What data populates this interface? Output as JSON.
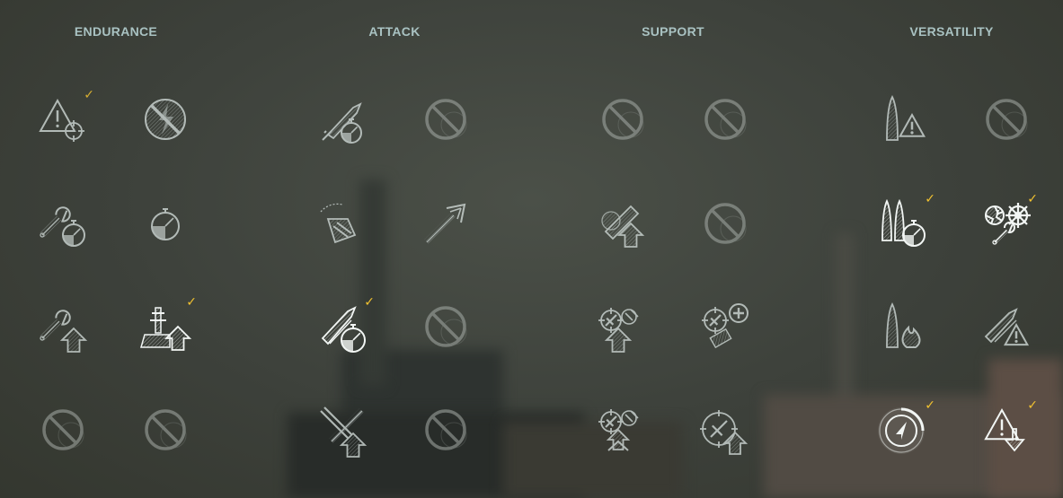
{
  "columns": [
    {
      "title": "ENDURANCE",
      "skills": [
        {
          "name": "incoming-fire-alert-icon",
          "icon": "alert",
          "state": "learned",
          "selected": true
        },
        {
          "name": "no-lightning-icon",
          "icon": "no-bolt",
          "state": "learned",
          "selected": false
        },
        {
          "name": "wrench-timer-icon",
          "icon": "wrench-timer",
          "state": "learned",
          "selected": false
        },
        {
          "name": "stopwatch-icon",
          "icon": "stopwatch",
          "state": "learned",
          "selected": false
        },
        {
          "name": "wrench-up-icon",
          "icon": "wrench-up",
          "state": "learned",
          "selected": false
        },
        {
          "name": "ship-up-icon",
          "icon": "ship-up",
          "state": "active",
          "selected": true
        },
        {
          "name": "locked-skill-icon",
          "icon": "blocked",
          "state": "locked",
          "selected": false
        },
        {
          "name": "locked-skill-icon",
          "icon": "blocked",
          "state": "locked",
          "selected": false
        }
      ]
    },
    {
      "title": "ATTACK",
      "skills": [
        {
          "name": "shell-timer-icon",
          "icon": "shell-timer",
          "state": "learned",
          "selected": false
        },
        {
          "name": "locked-skill-icon",
          "icon": "blocked",
          "state": "locked",
          "selected": false
        },
        {
          "name": "turret-icon",
          "icon": "turret",
          "state": "learned",
          "selected": false
        },
        {
          "name": "shell-range-icon",
          "icon": "shell-range",
          "state": "learned",
          "selected": false
        },
        {
          "name": "double-shell-timer-icon",
          "icon": "shells-timer",
          "state": "active",
          "selected": true
        },
        {
          "name": "locked-skill-icon",
          "icon": "blocked",
          "state": "locked",
          "selected": false
        },
        {
          "name": "crossed-guns-up-icon",
          "icon": "guns-up",
          "state": "learned",
          "selected": false
        },
        {
          "name": "locked-skill-icon",
          "icon": "blocked",
          "state": "locked",
          "selected": false
        }
      ]
    },
    {
      "title": "SUPPORT",
      "skills": [
        {
          "name": "locked-skill-icon",
          "icon": "blocked",
          "state": "locked",
          "selected": false
        },
        {
          "name": "locked-skill-icon",
          "icon": "blocked",
          "state": "locked",
          "selected": false
        },
        {
          "name": "consumable-up-icon",
          "icon": "consumable-up",
          "state": "learned",
          "selected": false
        },
        {
          "name": "locked-skill-icon",
          "icon": "blocked",
          "state": "locked",
          "selected": false
        },
        {
          "name": "aa-up-icon",
          "icon": "aa-up",
          "state": "learned",
          "selected": false
        },
        {
          "name": "aa-plus-icon",
          "icon": "aa-plus",
          "state": "learned",
          "selected": false
        },
        {
          "name": "aa-double-up-icon",
          "icon": "aa-double-up",
          "state": "learned",
          "selected": false
        },
        {
          "name": "aa-crosshair-up-icon",
          "icon": "aa-crosshair",
          "state": "learned",
          "selected": false
        }
      ]
    },
    {
      "title": "VERSATILITY",
      "skills": [
        {
          "name": "torpedo-alert-icon",
          "icon": "torpedo-alert",
          "state": "learned",
          "selected": false
        },
        {
          "name": "locked-skill-icon",
          "icon": "blocked",
          "state": "locked",
          "selected": false
        },
        {
          "name": "torpedo-timer-icon",
          "icon": "torpedo-timer",
          "state": "active",
          "selected": true
        },
        {
          "name": "rudder-propeller-icon",
          "icon": "rudder",
          "state": "active",
          "selected": true
        },
        {
          "name": "torpedo-fire-icon",
          "icon": "torpedo-fire",
          "state": "learned",
          "selected": false
        },
        {
          "name": "shells-alert-icon",
          "icon": "shells-alert",
          "state": "learned",
          "selected": false
        },
        {
          "name": "radar-arrow-icon",
          "icon": "radar",
          "state": "active",
          "selected": true
        },
        {
          "name": "alert-down-icon",
          "icon": "alert-down",
          "state": "active",
          "selected": true
        }
      ]
    }
  ],
  "checkmark": "✓",
  "colors": {
    "heading": "#a9c2c2",
    "icon_active": "#f2f6f4",
    "icon_learned": "#c7d0cd",
    "icon_locked": "#a6aca7",
    "checkmark": "#f2c230",
    "background": "#3f433d"
  }
}
